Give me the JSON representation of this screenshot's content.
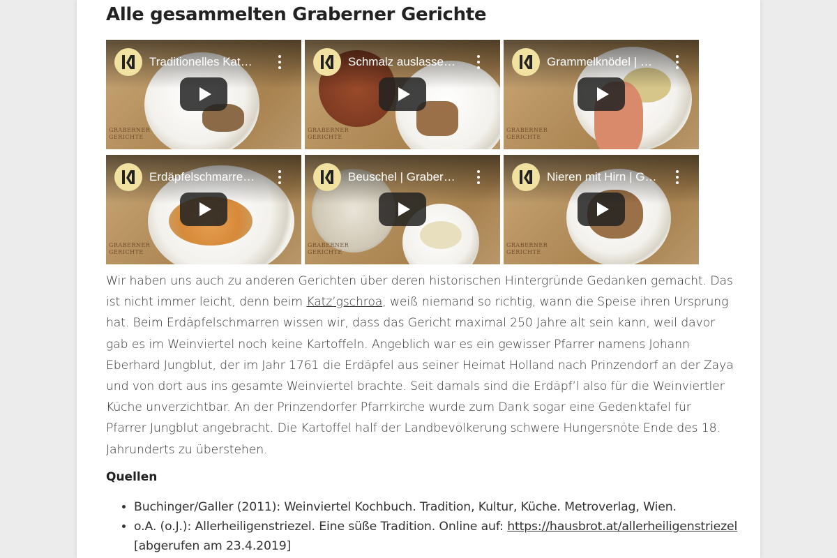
{
  "article": {
    "heading": "Alle gesammelten Graberner Gerichte",
    "videos": [
      {
        "title": "Traditionelles Kat…",
        "brand": "GRABERNER GERICHTE",
        "logo": "channel-logo-icon",
        "play": "play-icon",
        "menu": "more-options-icon"
      },
      {
        "title": "Schmalz auslasse…",
        "brand": "GRABERNER GERICHTE",
        "logo": "channel-logo-icon",
        "play": "play-icon",
        "menu": "more-options-icon"
      },
      {
        "title": "Grammelknödel | …",
        "brand": "GRABERNER GERICHTE",
        "logo": "channel-logo-icon",
        "play": "play-icon",
        "menu": "more-options-icon"
      },
      {
        "title": "Erdäpfelschmarre…",
        "brand": "GRABERNER GERICHTE",
        "logo": "channel-logo-icon",
        "play": "play-icon",
        "menu": "more-options-icon"
      },
      {
        "title": "Beuschel | Graber…",
        "brand": "GRABERNER GERICHTE",
        "logo": "channel-logo-icon",
        "play": "play-icon",
        "menu": "more-options-icon"
      },
      {
        "title": "Nieren mit Hirn | G…",
        "brand": "GRABERNER GERICHTE",
        "logo": "channel-logo-icon",
        "play": "play-icon",
        "menu": "more-options-icon"
      }
    ],
    "paragraph": {
      "part1": "Wir haben uns auch zu anderen Gerichten über deren historischen Hintergründe Gedanken gemacht. Das ist nicht immer leicht, denn beim ",
      "link": "Katz’gschroa",
      "part2": ", weiß niemand so richtig, wann die Speise ihren Ursprung hat. Beim Erdäpfelschmarren wissen wir, dass das Gericht maximal 250 Jahre alt sein kann, weil davor gab es im Weinviertel noch keine Kartoffeln. Angeblich war es ein gewisser Pfarrer namens Johann Eberhard Jungblut, der im Jahr 1761 die Erdäpfel aus seiner Heimat Holland nach Prinzendorf an der Zaya und von dort aus ins gesamte Weinviertel brachte. Seit damals sind die Erdäpf’l also für die Weinviertler Küche unverzichtbar. An der Prinzendorfer Pfarrkirche wurde zum Dank sogar eine Gedenktafel für Pfarrer Jungblut angebracht. Die Kartoffel half der Landbevölkerung schwere Hungersnöte Ende des 18. Jahrunderts zu überstehen."
    },
    "sources_heading": "Quellen",
    "sources": [
      {
        "text": "Buchinger/Galler (2011): Weinviertel Kochbuch. Tradition, Kultur, Küche. Metroverlag, Wien."
      },
      {
        "text_before": "o.A. (o.J.): Allerheiligenstriezel. Eine süße Tradition. Online auf: ",
        "link": "https://hausbrot.at/allerheiligenstriezel",
        "text_after": " [abgerufen am 23.4.2019]"
      }
    ]
  },
  "colors": {
    "page_bg": "#ececec",
    "card_bg": "#ffffff",
    "logo_bg": "#f1e2a2",
    "text": "#333333"
  }
}
